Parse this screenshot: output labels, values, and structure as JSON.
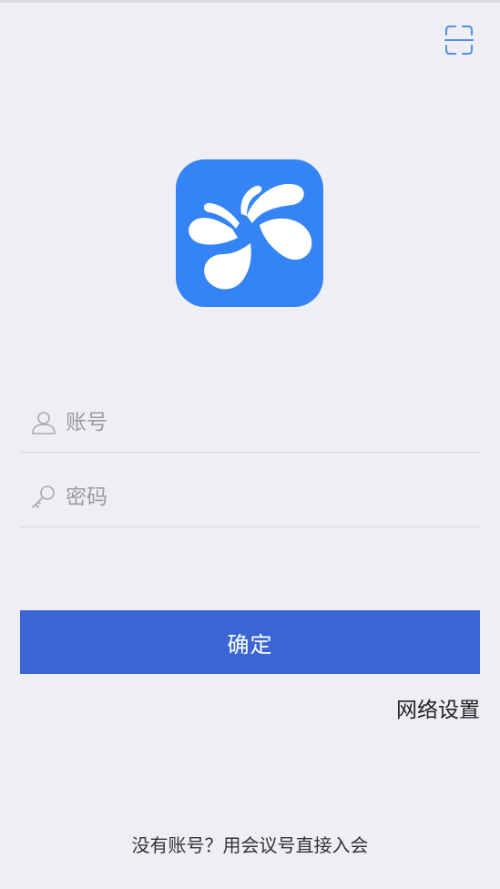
{
  "header": {
    "scan_icon": "scan-icon"
  },
  "logo": {
    "icon": "pinwheel-logo-icon",
    "background_color": "#3584f5"
  },
  "form": {
    "account_placeholder": "账号",
    "account_value": "",
    "account_icon": "user-icon",
    "password_placeholder": "密码",
    "password_value": "",
    "password_icon": "key-icon"
  },
  "actions": {
    "confirm_label": "确定",
    "confirm_color": "#3a66d3",
    "network_settings_label": "网络设置",
    "join_by_meeting_id_label": "没有账号？用会议号直接入会"
  }
}
